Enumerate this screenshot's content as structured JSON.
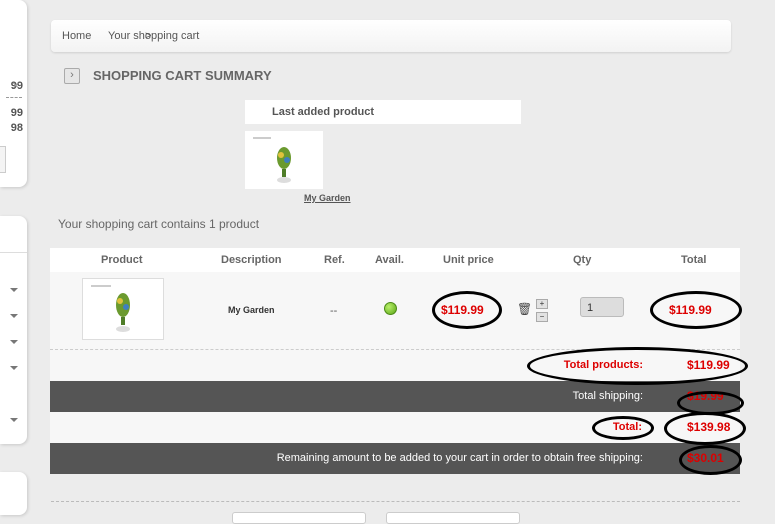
{
  "sidebar": {
    "cart_values": [
      "99",
      "99",
      "98"
    ],
    "remove_icon": "close-icon"
  },
  "breadcrumb": {
    "home": "Home",
    "separator": ">",
    "current": "Your shopping cart"
  },
  "page_title": "SHOPPING CART SUMMARY",
  "last_added": {
    "label": "Last added product",
    "product_name": "My Garden"
  },
  "summary_text": "Your shopping cart contains 1 product",
  "table": {
    "headers": [
      "Product",
      "Description",
      "Ref.",
      "Avail.",
      "Unit price",
      "Qty",
      "Total"
    ],
    "row": {
      "description": "My Garden",
      "ref": "--",
      "unit_price": "$119.99",
      "qty": "1",
      "total": "$119.99",
      "qty_plus": "+",
      "qty_minus": "−"
    }
  },
  "totals": {
    "products_label": "Total products:",
    "products_value": "$119.99",
    "shipping_label": "Total shipping:",
    "shipping_value": "$19.99",
    "total_label": "Total:",
    "total_value": "$139.98",
    "remaining_label": "Remaining amount to be added to your cart in order to obtain free shipping:",
    "remaining_value": "$30.01"
  },
  "colors": {
    "price_red": "#dd0000",
    "dark_row": "#555555",
    "avail_green": "#5aa516"
  }
}
